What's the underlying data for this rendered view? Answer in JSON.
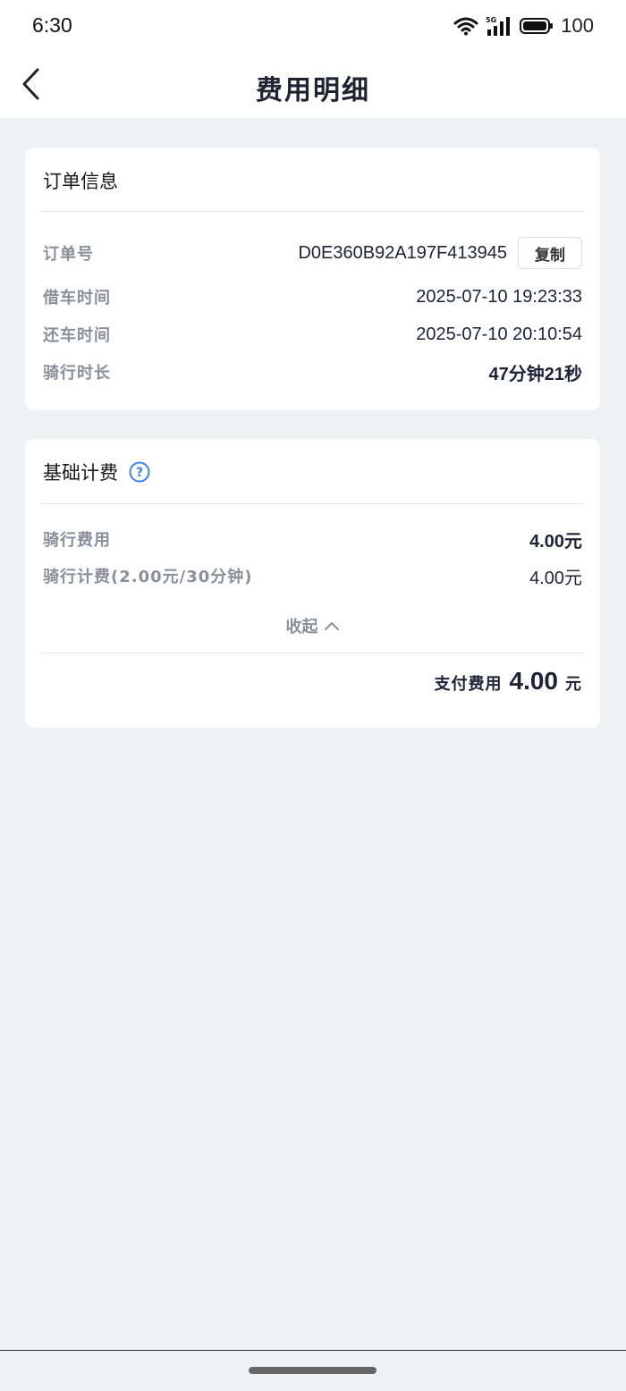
{
  "status_bar": {
    "time": "6:30",
    "battery": "100",
    "icons": [
      "wifi-icon",
      "signal-5g-icon",
      "battery-icon"
    ]
  },
  "nav": {
    "title": "费用明细",
    "back_icon": "chevron-left-icon"
  },
  "order_info": {
    "heading": "订单信息",
    "order_no_label": "订单号",
    "order_no": "D0E360B92A197F413945",
    "copy_label": "复制",
    "borrow_time_label": "借车时间",
    "borrow_time": "2025-07-10 19:23:33",
    "return_time_label": "还车时间",
    "return_time": "2025-07-10 20:10:54",
    "duration_label": "骑行时长",
    "duration": "47分钟21秒"
  },
  "billing": {
    "heading": "基础计费",
    "help_icon": "question-circle-icon",
    "ride_fee_label": "骑行费用",
    "ride_fee": "4.00元",
    "ride_rate_label": "骑行计费(2.00元/30分钟)",
    "ride_rate_fee": "4.00元",
    "collapse_label": "收起",
    "collapse_icon": "chevron-up-icon",
    "pay_label": "支付费用",
    "pay_amount": "4.00",
    "pay_unit": "元"
  },
  "colors": {
    "accent": "#3b82f6",
    "background": "#f0f1f3",
    "text": "#1d2236",
    "muted": "#8b8f9a"
  }
}
